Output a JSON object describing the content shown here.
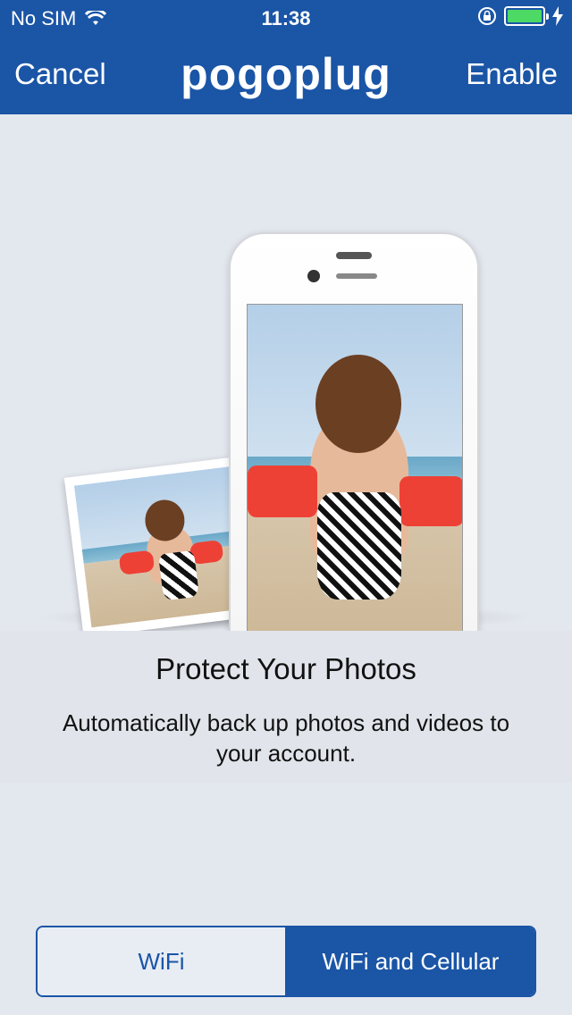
{
  "status_bar": {
    "carrier": "No SIM",
    "time": "11:38",
    "battery_level": 1.0
  },
  "nav": {
    "cancel_label": "Cancel",
    "title": "pogoplug",
    "enable_label": "Enable"
  },
  "content": {
    "headline": "Protect Your Photos",
    "description": "Automatically back up photos and videos to your account."
  },
  "network_options": {
    "options": [
      "WiFi",
      "WiFi and Cellular"
    ],
    "selected": "WiFi and Cellular"
  },
  "colors": {
    "brand_blue": "#1a55a6",
    "background": "#e3e7ee",
    "battery_green": "#4cd964"
  }
}
